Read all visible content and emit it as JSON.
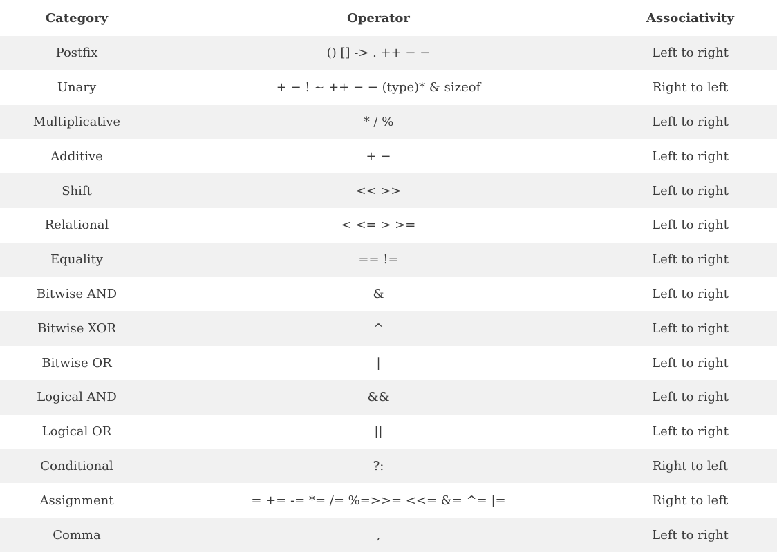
{
  "table": {
    "headers": {
      "category": "Category",
      "operator": "Operator",
      "associativity": "Associativity"
    },
    "rows": [
      {
        "category": "Postfix",
        "operator": "() [] -> . ++ − −",
        "associativity": "Left to right"
      },
      {
        "category": "Unary",
        "operator": "+ − ! ~ ++ − − (type)* & sizeof",
        "associativity": "Right to left"
      },
      {
        "category": "Multiplicative",
        "operator": "* / %",
        "associativity": "Left to right"
      },
      {
        "category": "Additive",
        "operator": "+ −",
        "associativity": "Left to right"
      },
      {
        "category": "Shift",
        "operator": "<< >>",
        "associativity": "Left to right"
      },
      {
        "category": "Relational",
        "operator": "< <= > >=",
        "associativity": "Left to right"
      },
      {
        "category": "Equality",
        "operator": "== !=",
        "associativity": "Left to right"
      },
      {
        "category": "Bitwise AND",
        "operator": "&",
        "associativity": "Left to right"
      },
      {
        "category": "Bitwise XOR",
        "operator": "^",
        "associativity": "Left to right"
      },
      {
        "category": "Bitwise OR",
        "operator": "|",
        "associativity": "Left to right"
      },
      {
        "category": "Logical AND",
        "operator": "&&",
        "associativity": "Left to right"
      },
      {
        "category": "Logical OR",
        "operator": "||",
        "associativity": "Left to right"
      },
      {
        "category": "Conditional",
        "operator": "?:",
        "associativity": "Right to left"
      },
      {
        "category": "Assignment",
        "operator": "= += -= *= /= %=>>= <<= &= ^= |=",
        "associativity": "Right to left"
      },
      {
        "category": "Comma",
        "operator": ",",
        "associativity": "Left to right"
      }
    ]
  },
  "colors": {
    "text": "#3a3a3a",
    "stripe": "#f1f1f1",
    "background": "#ffffff"
  }
}
